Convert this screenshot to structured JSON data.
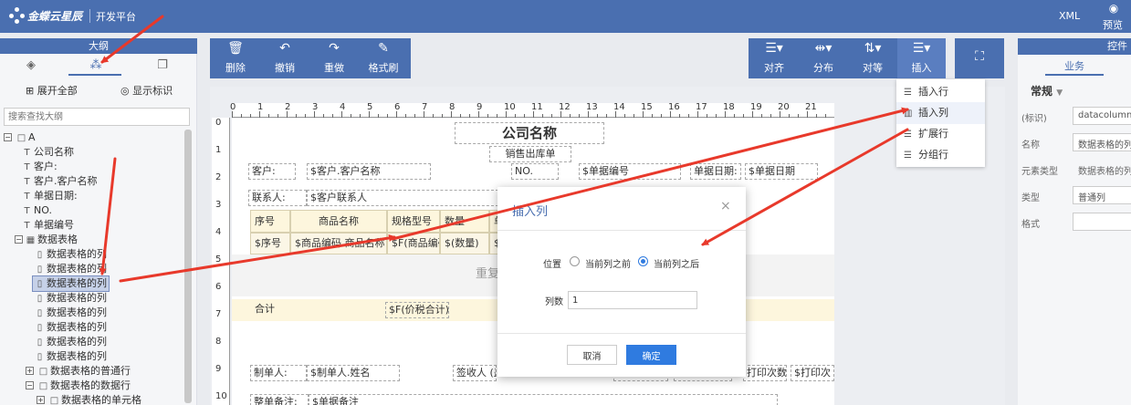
{
  "header": {
    "brand": "金蝶云星辰",
    "platform": "开发平台",
    "xml_label": "XML",
    "preview_label": "预览"
  },
  "outline": {
    "title": "大纲",
    "expand_all": "展开全部",
    "show_marks": "显示标识",
    "search_placeholder": "搜索查找大纲",
    "tree": [
      {
        "label": "A"
      },
      {
        "label": "公司名称"
      },
      {
        "label": "客户:"
      },
      {
        "label": "客户.客户名称"
      },
      {
        "label": "单据日期:"
      },
      {
        "label": "NO."
      },
      {
        "label": "单据编号"
      },
      {
        "label": "数据表格"
      },
      {
        "label": "数据表格的列"
      },
      {
        "label": "数据表格的列"
      },
      {
        "label": "数据表格的列"
      },
      {
        "label": "数据表格的列"
      },
      {
        "label": "数据表格的列"
      },
      {
        "label": "数据表格的列"
      },
      {
        "label": "数据表格的列"
      },
      {
        "label": "数据表格的列"
      },
      {
        "label": "数据表格的普通行"
      },
      {
        "label": "数据表格的数据行"
      },
      {
        "label": "数据表格的单元格"
      }
    ]
  },
  "toolbar": {
    "delete": "删除",
    "undo": "撤销",
    "redo": "重做",
    "format_painter": "格式刷",
    "align": "对齐",
    "distribute": "分布",
    "equalize": "对等",
    "insert": "插入"
  },
  "insert_menu": {
    "items": [
      {
        "label": "插入行"
      },
      {
        "label": "插入列"
      },
      {
        "label": "扩展行"
      },
      {
        "label": "分组行"
      }
    ]
  },
  "right_panel": {
    "title": "控件",
    "tab": "业务",
    "section": "常规",
    "fields": [
      {
        "label": "(标识)",
        "value": "datacolumn2"
      },
      {
        "label": "名称",
        "value": "数据表格的列"
      },
      {
        "label": "元素类型",
        "value": "数据表格的列"
      },
      {
        "label": "类型",
        "value": "普通列"
      },
      {
        "label": "格式",
        "value": ""
      }
    ]
  },
  "ruler": {
    "h": [
      "0",
      "1",
      "2",
      "3",
      "4",
      "5",
      "6",
      "7",
      "8",
      "9",
      "10",
      "11",
      "12",
      "13",
      "14",
      "15",
      "16",
      "17",
      "18",
      "19",
      "20",
      "21"
    ],
    "v": [
      "0",
      "1",
      "2",
      "3",
      "4",
      "5",
      "6",
      "7",
      "8",
      "9",
      "10"
    ]
  },
  "sheet": {
    "title": "公司名称",
    "subtitle": "销售出库单",
    "customer_label": "客户:",
    "customer_value": "$客户.客户名称",
    "no_label": "NO.",
    "no_value": "$单据编号",
    "date_label": "单据日期:",
    "date_value": "$单据日期",
    "contact_label": "联系人:",
    "contact_value": "$客户联系人",
    "columns": [
      "序号",
      "商品名称",
      "规格型号",
      "数量",
      "单"
    ],
    "data_row": [
      "$序号",
      "$商品编码.商品名称",
      "$F(商品编码.规格型号)",
      "$(数量)",
      "$"
    ],
    "grid_label": "数据",
    "repeat_label": "重复",
    "total_label": "合计",
    "total_value": "$F(价税合计)",
    "maker_label": "制单人:",
    "maker_value": "$制单人.姓名",
    "receiver_label": "签收人 (盖",
    "print_count_label": "打印次数",
    "print_count_value": "$打印次",
    "remark_label": "整单备注:",
    "remark_value": "$单据备注"
  },
  "modal": {
    "title": "插入列",
    "close": "×",
    "position_label": "位置",
    "before_label": "当前列之前",
    "after_label": "当前列之后",
    "count_label": "列数",
    "count_value": "1",
    "cancel": "取消",
    "ok": "确定"
  },
  "colors": {
    "primary": "#4a6fb0",
    "accent_button": "#2f7be0",
    "arrow": "#e8392b"
  }
}
